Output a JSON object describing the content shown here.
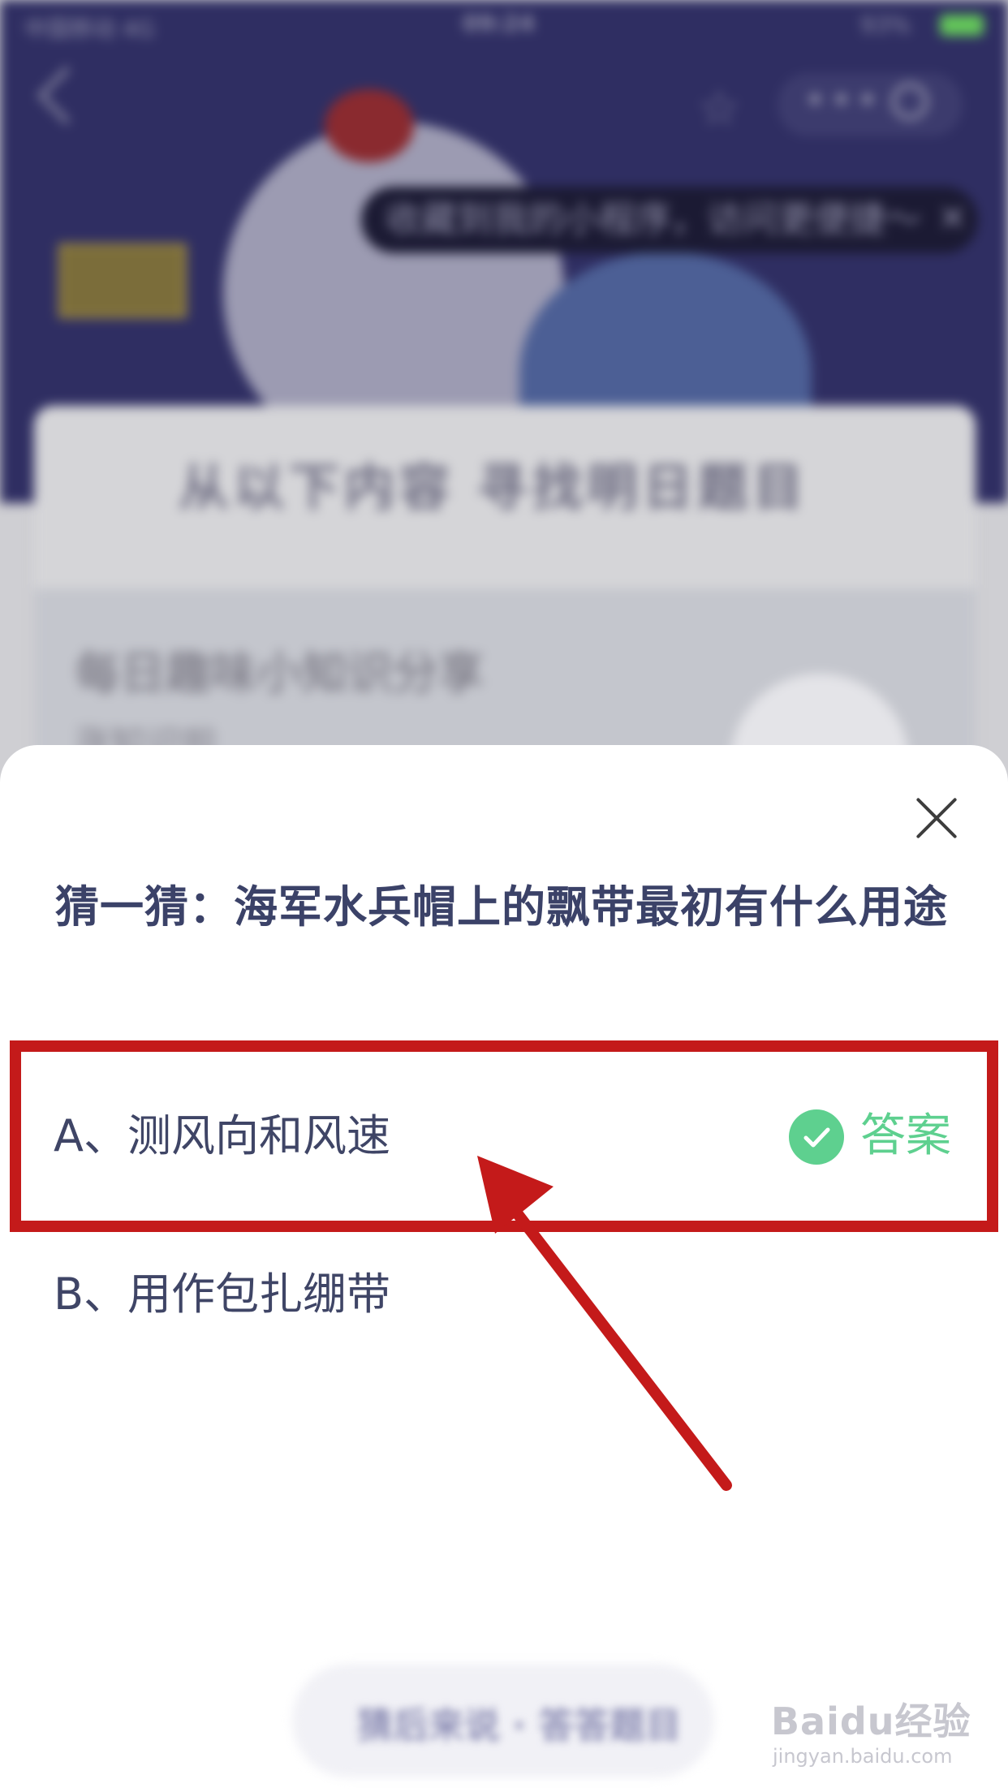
{
  "background": {
    "status_bar": {
      "carrier": "中国移动 4G",
      "time": "09:24",
      "battery": "93%"
    },
    "tooltip_text": "收藏到我的小程序，访问更便捷～",
    "heading": "从以下内容 寻找明日题目",
    "card_title": "每日趣味小知识分享",
    "card_subtitle": "涨知识啦"
  },
  "sheet": {
    "question": "猜一猜：海军水兵帽上的飘带最初有什么用途",
    "options": [
      {
        "label": "A、测风向和风速",
        "correct": true
      },
      {
        "label": "B、用作包扎绷带",
        "correct": false
      }
    ],
    "answer_label": "答案",
    "bottom_button": "猜后来说 · 答答题目"
  },
  "watermark": {
    "brand": "Baidu经验",
    "url": "jingyan.baidu.com"
  },
  "colors": {
    "accent_green": "#5ed08f",
    "annotation_red": "#c41a1a",
    "question_text": "#3b4268"
  }
}
